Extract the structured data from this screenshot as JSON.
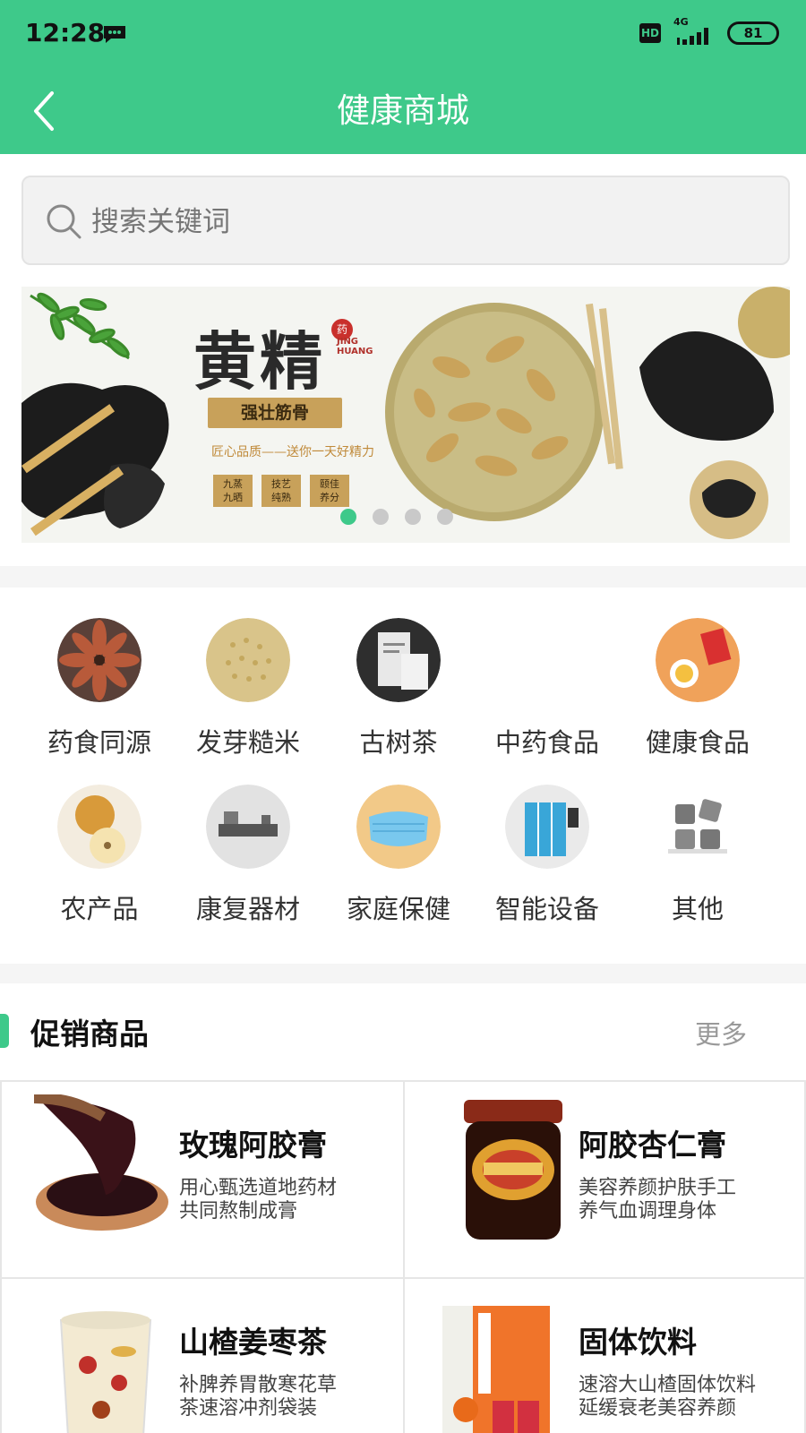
{
  "status": {
    "time": "12:28",
    "hd": "HD",
    "network": "4G",
    "battery": "81"
  },
  "header": {
    "title": "健康商城"
  },
  "search": {
    "placeholder": "搜索关键词"
  },
  "banner": {
    "title": "黄精",
    "seal": "药",
    "pinyin": "JING HUANG",
    "ribbon": "强壮筋骨",
    "tagline": "匠心品质——送你一天好精力",
    "tags": [
      {
        "l1": "九蒸",
        "l2": "九晒"
      },
      {
        "l1": "技艺",
        "l2": "纯熟"
      },
      {
        "l1": "颐佳",
        "l2": "养分"
      }
    ],
    "active_slide": 1,
    "slide_count": 4
  },
  "categories": [
    {
      "label": "药食同源",
      "icon": "star-anise-icon"
    },
    {
      "label": "发芽糙米",
      "icon": "rice-icon"
    },
    {
      "label": "古树茶",
      "icon": "tea-bag-icon"
    },
    {
      "label": "中药食品",
      "icon": "blank-icon"
    },
    {
      "label": "健康食品",
      "icon": "health-food-icon"
    },
    {
      "label": "农产品",
      "icon": "pear-icon"
    },
    {
      "label": "康复器材",
      "icon": "rehab-device-icon"
    },
    {
      "label": "家庭保健",
      "icon": "face-mask-icon"
    },
    {
      "label": "智能设备",
      "icon": "smart-cabinet-icon"
    },
    {
      "label": "其他",
      "icon": "grid-other-icon"
    }
  ],
  "promo": {
    "heading": "促销商品",
    "more": "更多",
    "items": [
      {
        "name": "玫瑰阿胶膏",
        "desc1": "用心甄选道地药材",
        "desc2": "共同熬制成膏"
      },
      {
        "name": "阿胶杏仁膏",
        "desc1": "美容养颜护肤手工",
        "desc2": "养气血调理身体"
      },
      {
        "name": "山楂姜枣茶",
        "desc1": "补脾养胃散寒花草",
        "desc2": "茶速溶冲剂袋装"
      },
      {
        "name": "固体饮料",
        "desc1": "速溶大山楂固体饮料",
        "desc2": "延缓衰老美容养颜"
      }
    ]
  },
  "colors": {
    "brand": "#3ec98a",
    "separator": "#f5f5f5",
    "text": "#222222"
  }
}
